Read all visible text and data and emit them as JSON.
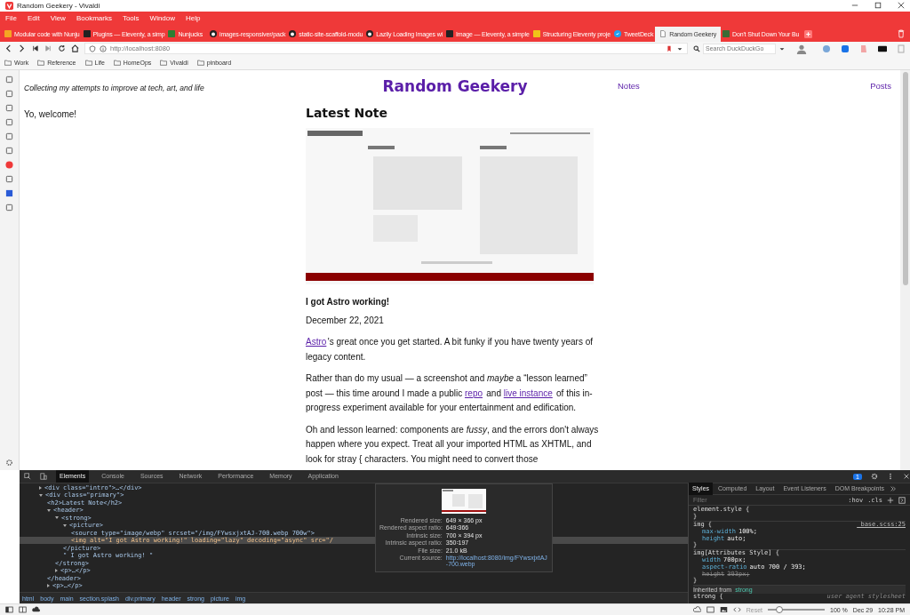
{
  "window": {
    "title": "Random Geekery - Vivaldi"
  },
  "menu": [
    "File",
    "Edit",
    "View",
    "Bookmarks",
    "Tools",
    "Window",
    "Help"
  ],
  "tabs": [
    {
      "label": "Modular code with Nunju",
      "selected": false,
      "kind": "square",
      "color": "#f5a623"
    },
    {
      "label": "Plugins — Eleventy, a simp",
      "selected": false,
      "kind": "square",
      "color": "#222222"
    },
    {
      "label": "Nunjucks",
      "selected": false,
      "kind": "square",
      "color": "#2e7d32"
    },
    {
      "label": "images-responsiver/pack",
      "selected": false,
      "kind": "github"
    },
    {
      "label": "static-site-scaffold-modu",
      "selected": false,
      "kind": "github"
    },
    {
      "label": "Lazily Loading Images wi",
      "selected": false,
      "kind": "github"
    },
    {
      "label": "Image — Eleventy, a simple",
      "selected": false,
      "kind": "square",
      "color": "#222222"
    },
    {
      "label": "Structuring Eleventy proje",
      "selected": false,
      "kind": "square",
      "color": "#f0c419"
    },
    {
      "label": "TweetDeck",
      "selected": false,
      "kind": "bird"
    },
    {
      "label": "Random Geekery",
      "selected": true,
      "kind": "page"
    },
    {
      "label": "Don't Shut Down Your Bu",
      "selected": false,
      "kind": "square",
      "color": "#3a6b35"
    }
  ],
  "address": {
    "url": "http://localhost:8080",
    "search_placeholder": "Search DuckDuckGo"
  },
  "bookmarks": [
    "Work",
    "Reference",
    "Life",
    "HomeOps",
    "Vivaldi",
    "pinboard"
  ],
  "page": {
    "tagline": "Collecting my attempts to improve at tech, art, and life",
    "site_title": "Random Geekery",
    "nav": [
      "Notes",
      "Posts"
    ],
    "welcome": "Yo, welcome!",
    "heading": "Latest Note",
    "image": {
      "kind": "picture"
    },
    "note_title": "I got Astro working!",
    "date": "December 22, 2021",
    "paragraphs": [
      [
        {
          "kind": "link",
          "text": "Astro"
        },
        {
          "kind": "text",
          "text": "'s great once you get started. A bit funky if you have twenty years of legacy content."
        }
      ],
      [
        {
          "kind": "text",
          "text": "Rather than do my usual — a screenshot and *maybe* a “lesson learned” post — this time around I made a public "
        },
        {
          "kind": "link",
          "text": "repo"
        },
        {
          "kind": "text",
          "text": " and "
        },
        {
          "kind": "link",
          "text": "live instance"
        },
        {
          "kind": "text",
          "text": " of this in-progress experiment available for your entertainment and edification."
        }
      ],
      [
        {
          "kind": "text",
          "text": "Oh and lesson learned: components are *fussy*, and the errors don't always happen where you expect. Treat all your imported HTML as XHTML, and look for stray { characters. You might need to convert those"
        }
      ]
    ]
  },
  "devtools": {
    "tabs": [
      {
        "label": "Elements",
        "selected": true
      },
      {
        "label": "Console",
        "selected": false
      },
      {
        "label": "Sources",
        "selected": false
      },
      {
        "label": "Network",
        "selected": false
      },
      {
        "label": "Performance",
        "selected": false
      },
      {
        "label": "Memory",
        "selected": false
      },
      {
        "label": "Application",
        "selected": false
      }
    ],
    "issues": "1",
    "dom": [
      {
        "open": "<div class=\"intro\">…</div>",
        "expanded": false,
        "selected": false
      },
      {
        "open": "<div class=\"primary\">",
        "expanded": true,
        "selected": false,
        "children": [
          {
            "open": "<h2>Latest Note</h2>",
            "selected": false
          },
          {
            "open": "<header>",
            "expanded": true,
            "selected": false,
            "children": [
              {
                "open": "<strong>",
                "expanded": true,
                "selected": false,
                "children": [
                  {
                    "open": "<picture>",
                    "expanded": true,
                    "selected": false,
                    "children": [
                      {
                        "open": "<source type=\"image/webp\" srcset=\"/img/FYwsxjxtAJ-700.webp 700w\">",
                        "selected": false
                      },
                      {
                        "open": "<img alt=\"I got Astro working!\" loading=\"lazy\" decoding=\"async\" src=\"/",
                        "selected": true
                      }
                    ],
                    "close": "</picture>"
                  },
                  {
                    "open": "\" I got Astro working! \"",
                    "selected": false
                  }
                ],
                "close": "</strong>"
              },
              {
                "open": "<p>…</p>",
                "expanded": false,
                "selected": false
              }
            ],
            "close": "</header>"
          },
          {
            "open": "<p>…</p>",
            "expanded": false,
            "selected": false
          }
        ]
      }
    ],
    "tooltip": {
      "thumbnail": {
        "kind": "picture"
      },
      "rows": [
        {
          "label": "Rendered size:",
          "value": "649 × 366 px"
        },
        {
          "label": "Rendered aspect ratio:",
          "value": "649∶366"
        },
        {
          "label": "Intrinsic size:",
          "value": "700 × 394 px"
        },
        {
          "label": "Intrinsic aspect ratio:",
          "value": "350∶197"
        },
        {
          "label": "File size:",
          "value": "21.0 kB"
        }
      ],
      "source_label": "Current source:",
      "source": "http://localhost:8080/img/FYwsxjxtAJ-700.webp"
    },
    "breadcrumbs": [
      "html",
      "body",
      "main",
      "section.splash",
      "div.primary",
      "header",
      "strong",
      "picture",
      "img"
    ],
    "styles": {
      "tabs": [
        {
          "label": "Styles",
          "selected": true
        },
        {
          "label": "Computed",
          "selected": false
        },
        {
          "label": "Layout",
          "selected": false
        },
        {
          "label": "Event Listeners",
          "selected": false
        },
        {
          "label": "DOM Breakpoints",
          "selected": false
        }
      ],
      "filter_placeholder": "Filter",
      "hov": ":hov",
      "cls": ".cls",
      "rules": [
        {
          "selector": "element.style {",
          "close": "}"
        },
        {
          "selector": "img {",
          "source": "_base.scss:25",
          "props": [
            {
              "name": "max-width",
              "value": "100%;",
              "struck": false
            },
            {
              "name": "height",
              "value": "auto;",
              "struck": false
            }
          ],
          "close": "}"
        },
        {
          "selector": "img[Attributes Style] {",
          "props": [
            {
              "name": "width",
              "value": "700px;",
              "struck": false
            },
            {
              "name": "aspect-ratio",
              "value": "auto 700 / 393;",
              "struck": false
            },
            {
              "name": "height",
              "value": "393px;",
              "struck": true
            }
          ],
          "close": "}"
        }
      ],
      "inherited_label": "Inherited from",
      "inherited_from": "strong",
      "last_selector": "strong {",
      "last_source": "user agent stylesheet"
    }
  },
  "status": {
    "reset": "Reset",
    "zoom": {
      "level": 0.2
    },
    "zoom_text": "100 %",
    "date": "Dec 29",
    "time": "10:28 PM"
  }
}
